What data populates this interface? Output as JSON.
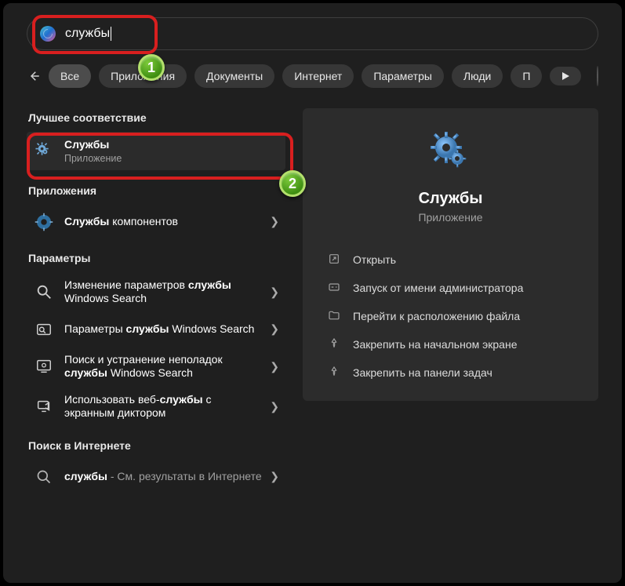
{
  "search": {
    "value": "службы"
  },
  "filters": {
    "items": [
      "Все",
      "Приложения",
      "Документы",
      "Интернет",
      "Параметры",
      "Люди",
      "П"
    ],
    "active_index": 0
  },
  "left": {
    "best_label": "Лучшее соответствие",
    "best": {
      "title": "Службы",
      "subtitle": "Приложение"
    },
    "apps_label": "Приложения",
    "apps": [
      {
        "pre": "Службы",
        "post": " компонентов"
      }
    ],
    "settings_label": "Параметры",
    "settings": [
      {
        "pre": "Изменение параметров ",
        "bold": "службы",
        "post": " Windows Search"
      },
      {
        "pre": "Параметры ",
        "bold": "службы",
        "post": " Windows Search"
      },
      {
        "pre": "Поиск и устранение неполадок ",
        "bold": "службы",
        "post": " Windows Search"
      },
      {
        "pre": "Использовать веб-",
        "bold": "службы",
        "post": " с экранным диктором"
      }
    ],
    "web_label": "Поиск в Интернете",
    "web": [
      {
        "bold": "службы",
        "hint": " - См. результаты в Интернете"
      }
    ]
  },
  "panel": {
    "title": "Службы",
    "subtitle": "Приложение",
    "actions": [
      "Открыть",
      "Запуск от имени администратора",
      "Перейти к расположению файла",
      "Закрепить на начальном экране",
      "Закрепить на панели задач"
    ]
  },
  "badges": {
    "one": "1",
    "two": "2"
  }
}
